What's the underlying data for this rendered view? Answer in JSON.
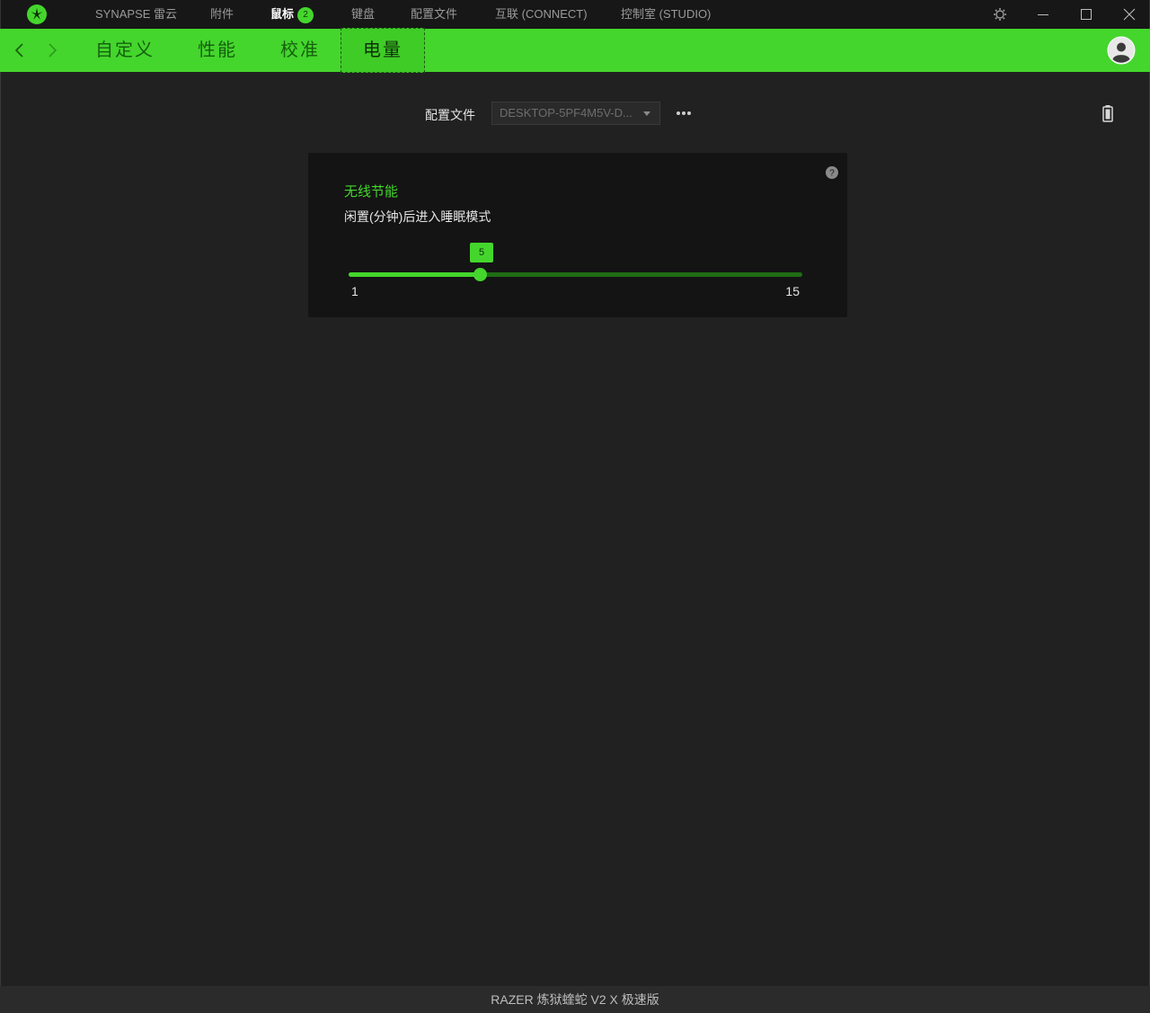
{
  "titlebar": {
    "nav": [
      {
        "label": "SYNAPSE 雷云"
      },
      {
        "label": "附件"
      },
      {
        "label": "鼠标",
        "badge": "2",
        "active": true
      },
      {
        "label": "键盘"
      },
      {
        "label": "配置文件"
      },
      {
        "label": "互联 (CONNECT)"
      },
      {
        "label": "控制室 (STUDIO)"
      }
    ],
    "icons": [
      "settings-gear-icon",
      "minimize-icon",
      "maximize-icon",
      "close-icon"
    ]
  },
  "subnav": {
    "tabs": [
      {
        "label": "自定义"
      },
      {
        "label": "性能"
      },
      {
        "label": "校准"
      },
      {
        "label": "电量",
        "active": true
      }
    ]
  },
  "profile": {
    "label": "配置文件",
    "selected": "DESKTOP-5PF4M5V-D..."
  },
  "power_card": {
    "title": "无线节能",
    "subtitle": "闲置(分钟)后进入睡眠模式",
    "slider": {
      "min": 1,
      "max": 15,
      "value": 5,
      "min_label": "1",
      "max_label": "15",
      "value_label": "5"
    }
  },
  "footer": {
    "device_name": "RAZER 炼狱蝰蛇 V2 X 极速版"
  },
  "colors": {
    "accent": "#44d62c",
    "background": "#212121",
    "card": "#141414"
  }
}
